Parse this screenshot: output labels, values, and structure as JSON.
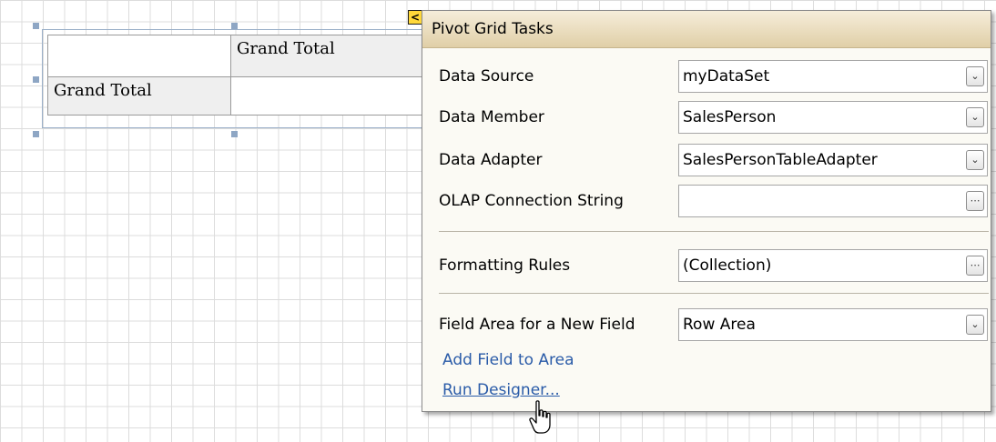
{
  "pivot_grid": {
    "column_header": "Grand Total",
    "row_header": "Grand Total"
  },
  "smart_tag": {
    "glyph": "<"
  },
  "tasks_panel": {
    "title": "Pivot Grid Tasks",
    "rows": [
      {
        "label": "Data Source",
        "value": "myDataSet",
        "button": "dropdown"
      },
      {
        "label": "Data Member",
        "value": "SalesPerson",
        "button": "dropdown"
      },
      {
        "label": "Data Adapter",
        "value": "SalesPersonTableAdapter",
        "button": "dropdown"
      },
      {
        "label": "OLAP Connection String",
        "value": "",
        "button": "ellipsis"
      },
      {
        "label": "Formatting Rules",
        "value": "(Collection)",
        "button": "ellipsis"
      },
      {
        "label": "Field Area for a New Field",
        "value": "Row Area",
        "button": "dropdown"
      }
    ],
    "links": {
      "add_field": "Add Field to Area",
      "run_designer": "Run Designer..."
    }
  },
  "icons": {
    "dropdown": "chevron-down-icon",
    "ellipsis": "ellipsis-icon",
    "cursor": "hand-pointer-icon"
  },
  "colors": {
    "panel_header_top": "#f6edda",
    "panel_header_bottom": "#e0cfa7",
    "link": "#2a5ba8",
    "smart_tag": "#ffd83a"
  }
}
